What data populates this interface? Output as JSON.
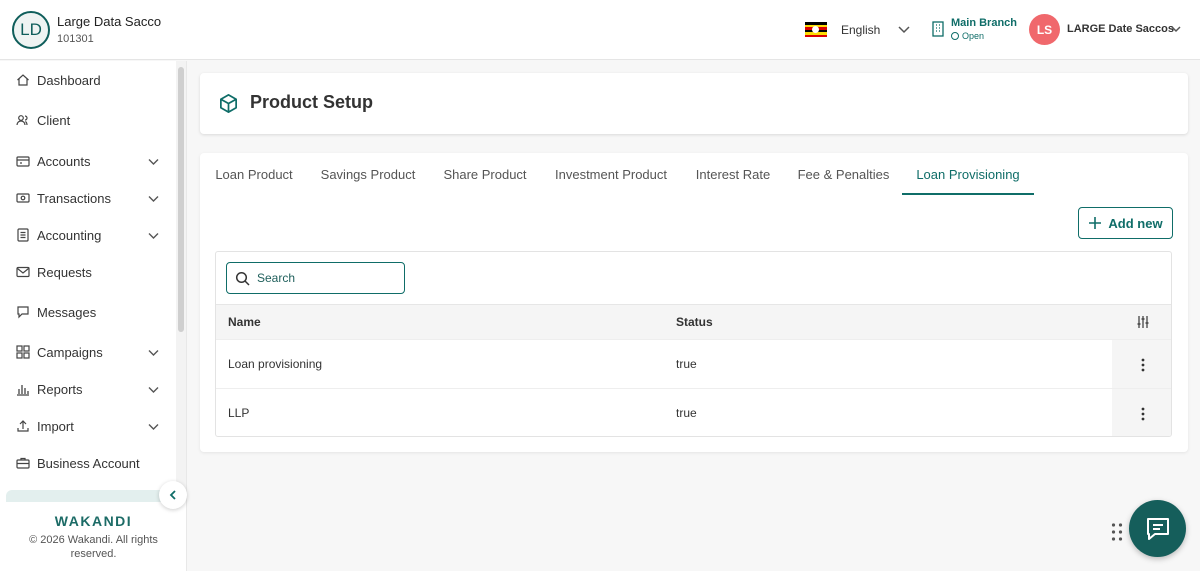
{
  "org": {
    "initials": "LD",
    "name": "Large Data Sacco",
    "id": "101301"
  },
  "header": {
    "language": "English",
    "branch_name": "Main Branch",
    "branch_status": "Open",
    "user_initials": "LS",
    "user_name": "LARGE Date Saccos"
  },
  "colors": {
    "primary": "#0f6d68",
    "avatar_user": "#f0686c",
    "flag": [
      "#000000",
      "#fcdc04",
      "#d90000"
    ]
  },
  "sidebar": {
    "items": [
      {
        "label": "Dashboard",
        "icon": "home-icon"
      },
      {
        "label": "Client",
        "icon": "users-icon"
      },
      {
        "label": "Accounts",
        "icon": "wallet-icon"
      },
      {
        "label": "Transactions",
        "icon": "cash-icon"
      },
      {
        "label": "Accounting",
        "icon": "ledger-icon"
      },
      {
        "label": "Requests",
        "icon": "mail-icon"
      },
      {
        "label": "Messages",
        "icon": "chat-icon"
      },
      {
        "label": "Campaigns",
        "icon": "grid-icon"
      },
      {
        "label": "Reports",
        "icon": "bar-chart-icon"
      },
      {
        "label": "Import",
        "icon": "upload-icon"
      },
      {
        "label": "Business Account",
        "icon": "briefcase-icon"
      }
    ],
    "brand": "WAKANDI",
    "copyright": "© 2026 Wakandi. All rights reserved."
  },
  "page": {
    "title": "Product Setup"
  },
  "tabs": [
    {
      "label": "Loan Product"
    },
    {
      "label": "Savings Product"
    },
    {
      "label": "Share Product"
    },
    {
      "label": "Investment Product"
    },
    {
      "label": "Interest Rate"
    },
    {
      "label": "Fee & Penalties"
    },
    {
      "label": "Loan Provisioning",
      "active": true
    }
  ],
  "actions": {
    "add_new": "Add new"
  },
  "search": {
    "placeholder": "Search"
  },
  "table": {
    "columns": [
      "Name",
      "Status"
    ],
    "rows": [
      {
        "name": "Loan provisioning",
        "status": "true"
      },
      {
        "name": "LLP",
        "status": "true"
      }
    ]
  }
}
